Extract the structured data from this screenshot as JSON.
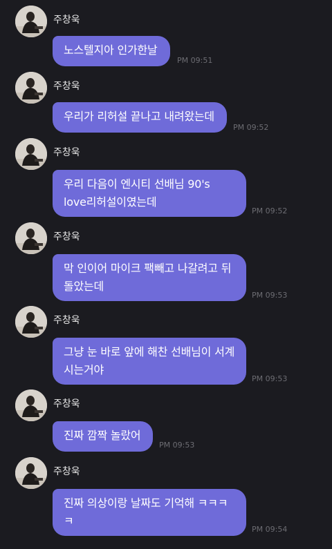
{
  "chat": {
    "avatar_icon": "profile-photo",
    "bubble_color": "#6f6bd9",
    "background_color": "#1b1b20",
    "messages": [
      {
        "sender": "주창욱",
        "text": "노스텔지아 인가한날",
        "time": "PM 09:51"
      },
      {
        "sender": "주창욱",
        "text": "우리가 리허설 끝나고 내려왔는데",
        "time": "PM 09:52"
      },
      {
        "sender": "주창욱",
        "text": "우리 다음이 엔시티 선배님 90's\nlove리허설이였는데",
        "time": "PM 09:52"
      },
      {
        "sender": "주창욱",
        "text": "막 인이어 마이크 팩빼고 나갈려고 뒤\n돌았는데",
        "time": "PM 09:53"
      },
      {
        "sender": "주창욱",
        "text": "그냥 눈 바로 앞에 해찬 선배님이 서계\n시는거야",
        "time": "PM 09:53"
      },
      {
        "sender": "주창욱",
        "text": "진짜 깜짝 놀랐어",
        "time": "PM 09:53"
      },
      {
        "sender": "주창욱",
        "text": "진짜 의상이랑 날짜도 기억해 ㅋㅋㅋ\nㅋ",
        "time": "PM 09:54"
      }
    ]
  }
}
